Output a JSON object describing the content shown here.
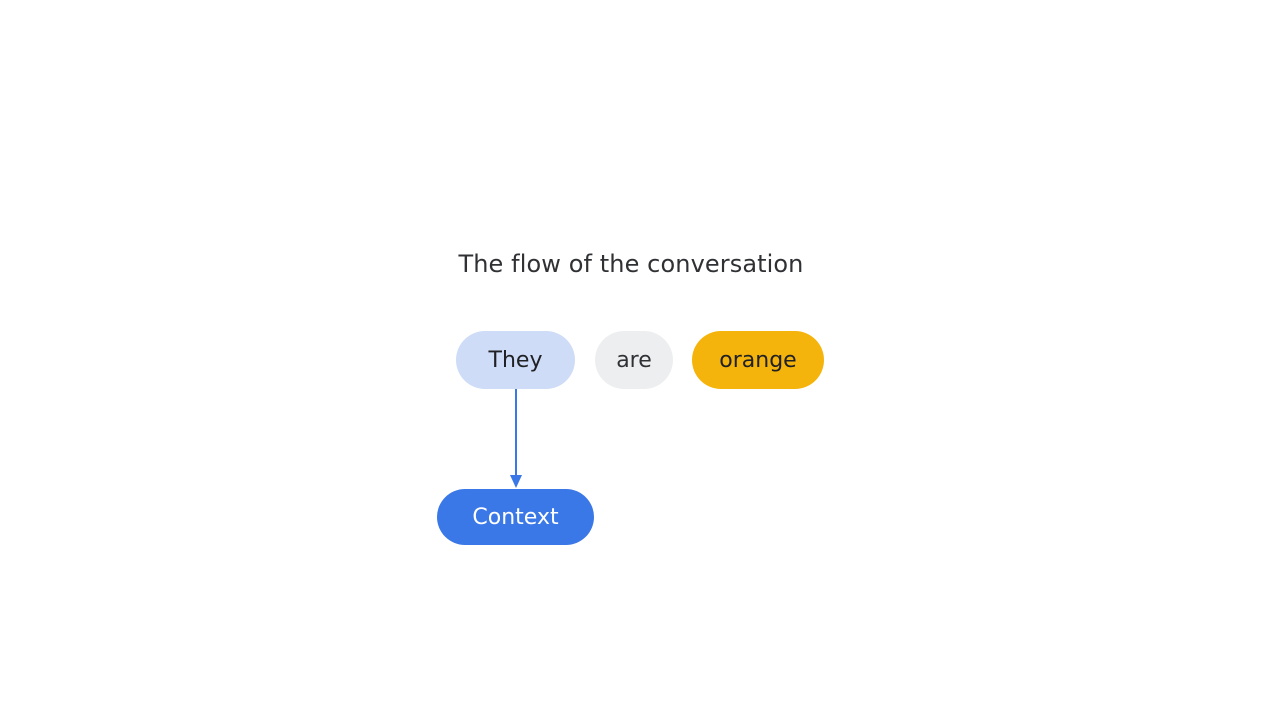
{
  "diagram": {
    "title": "The flow of the conversation",
    "tokens": [
      {
        "label": "They",
        "color": "#cfdcf7"
      },
      {
        "label": "are",
        "color": "#eceef0"
      },
      {
        "label": "orange",
        "color": "#f4b40b"
      }
    ],
    "target": {
      "label": "Context",
      "color": "#3b78e7"
    },
    "arrow_color": "#3b78e7"
  }
}
